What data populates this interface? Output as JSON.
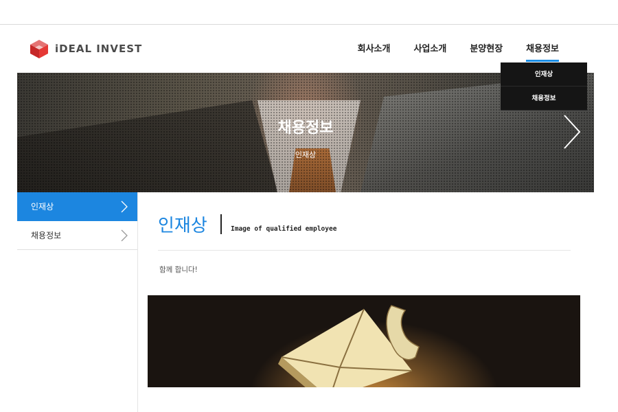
{
  "header": {
    "logo_text": "iDEAL INVEST",
    "nav": [
      {
        "label": "회사소개"
      },
      {
        "label": "사업소개"
      },
      {
        "label": "분양현장"
      },
      {
        "label": "채용정보"
      }
    ],
    "dropdown": [
      {
        "label": "인재상"
      },
      {
        "label": "채용정보"
      }
    ]
  },
  "banner": {
    "title": "채용정보",
    "subtitle": "인재상",
    "next_icon": "chevron-right-icon"
  },
  "sidebar": {
    "items": [
      {
        "label": "인재상",
        "active": true
      },
      {
        "label": "채용정보",
        "active": false
      }
    ]
  },
  "content": {
    "title": "인재상",
    "subtitle": "Image of qualified employee",
    "text": "함께 합니다!"
  },
  "colors": {
    "accent": "#1c86e0",
    "dropdown_bg": "#151515",
    "logo_red": "#d9534f"
  }
}
